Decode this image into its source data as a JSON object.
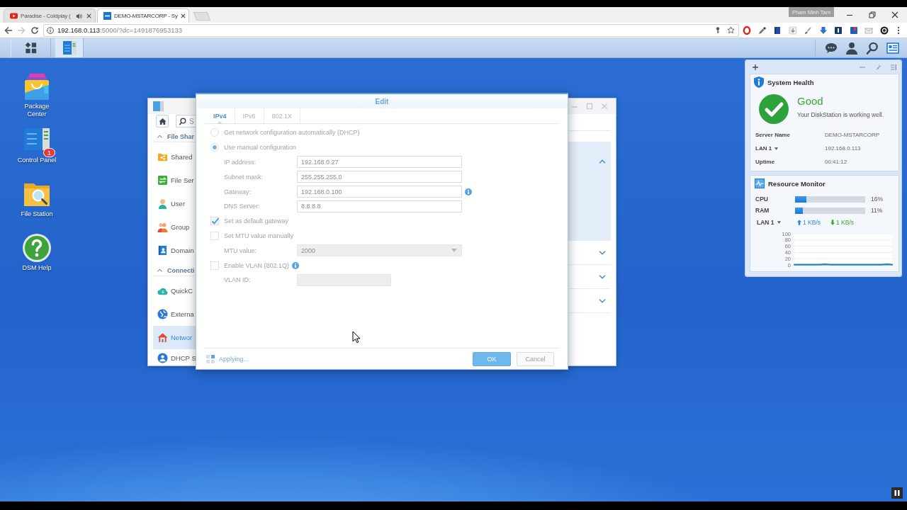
{
  "browser": {
    "tabs": [
      {
        "kind": "video",
        "title": "Paradise - Coldplay (",
        "selected": false,
        "audio": true
      },
      {
        "kind": "app",
        "title": "DEMO-MSTARCORP - Sy",
        "selected": true,
        "audio": false
      }
    ],
    "profile": "Pham Minh Tam",
    "url": {
      "host": "192.168.0.113",
      "rest": ":5000/?dc=1491876953133"
    }
  },
  "taskbar": {
    "apps": [
      {
        "kind": "main-menu",
        "selected": false
      },
      {
        "kind": "control-panel",
        "selected": true
      }
    ]
  },
  "desktop_icons": [
    {
      "kind": "package",
      "label": "Package Center"
    },
    {
      "kind": "control-panel",
      "label": "Control Panel",
      "badge": "1"
    },
    {
      "kind": "file-station",
      "label": "File Station"
    },
    {
      "kind": "help",
      "label": "DSM Help"
    }
  ],
  "control_panel": {
    "search": {
      "placeholder": "S"
    },
    "sections": [
      {
        "title": "File Shar",
        "expanded": true,
        "items": [
          {
            "kind": "shared",
            "label": "Shared",
            "selected": false
          },
          {
            "kind": "file-services",
            "label": "File Ser",
            "selected": false
          },
          {
            "kind": "user",
            "label": "User",
            "selected": false
          },
          {
            "kind": "group",
            "label": "Group",
            "selected": false
          },
          {
            "kind": "domain",
            "label": "Domain",
            "selected": false
          }
        ]
      },
      {
        "title": "Connecti",
        "expanded": true,
        "items": [
          {
            "kind": "quickconnect",
            "label": "QuickC",
            "selected": false
          },
          {
            "kind": "external",
            "label": "Externa",
            "selected": false
          },
          {
            "kind": "network",
            "label": "Networ",
            "selected": true
          },
          {
            "kind": "dhcp",
            "label": "DHCP S",
            "selected": false
          }
        ]
      }
    ],
    "interfaces": [
      {
        "expanded": true,
        "selected": true
      },
      {
        "expanded": false,
        "selected": false
      },
      {
        "expanded": false,
        "selected": false
      },
      {
        "expanded": false,
        "selected": false
      }
    ]
  },
  "dialog": {
    "title": "Edit",
    "tabs": [
      {
        "label": "IPv4",
        "selected": true
      },
      {
        "label": "IPv6",
        "selected": false
      },
      {
        "label": "802.1X",
        "selected": false
      }
    ],
    "rows": [
      {
        "kind": "radio",
        "label": "Get network configuration automatically (DHCP)",
        "selected": false,
        "disabled": false,
        "info": false
      },
      {
        "kind": "radio",
        "label": "Use manual configuration",
        "selected": true,
        "disabled": false,
        "info": false
      },
      {
        "kind": "field",
        "label": "IP address:",
        "value": "192.168.0.27",
        "disabled": false,
        "info": false
      },
      {
        "kind": "field",
        "label": "Subnet mask:",
        "value": "255.255.255.0",
        "disabled": false,
        "info": false
      },
      {
        "kind": "field",
        "label": "Gateway:",
        "value": "192.168.0.100",
        "disabled": false,
        "info": true
      },
      {
        "kind": "field",
        "label": "DNS Server:",
        "value": "8.8.8.8",
        "disabled": false,
        "info": false
      },
      {
        "kind": "checkbox",
        "label": "Set as default gateway",
        "checked": true,
        "disabled": false,
        "info": false
      },
      {
        "kind": "checkbox",
        "label": "Set MTU value manually",
        "checked": false,
        "disabled": false,
        "info": false
      },
      {
        "kind": "select",
        "label": "MTU value:",
        "value": "2000",
        "disabled": true,
        "info": false
      },
      {
        "kind": "checkbox",
        "label": "Enable VLAN (802.1Q)",
        "checked": false,
        "disabled": false,
        "info": true
      },
      {
        "kind": "short-field",
        "label": "VLAN ID:",
        "disabled": true,
        "info": false
      }
    ],
    "status": "Applying...",
    "buttons": [
      {
        "kind": "primary",
        "label": "OK"
      },
      {
        "kind": "secondary",
        "label": "Cancel"
      }
    ]
  },
  "widgets": {
    "health": {
      "title": "System Health",
      "status": "Good",
      "message": "Your DiskStation is working well.",
      "rows": [
        {
          "label": "Server Name",
          "value": "DEMO-MSTARCORP",
          "dropdown": false
        },
        {
          "label": "LAN 1",
          "value": "192.168.0.113",
          "dropdown": true
        },
        {
          "label": "Uptime",
          "value": "00:41:12",
          "dropdown": false
        }
      ]
    },
    "monitor": {
      "title": "Resource Monitor",
      "meters": [
        {
          "label": "CPU",
          "level": 0.16,
          "reading": "16%"
        },
        {
          "label": "RAM",
          "level": 0.11,
          "reading": "11%"
        }
      ],
      "lan": {
        "label": "LAN 1",
        "upload": "1 KB/s",
        "download": "1 KB/s"
      },
      "chart_data": {
        "type": "line",
        "ylim": [
          0,
          100
        ],
        "yticks": [
          0,
          20,
          40,
          60,
          80,
          100
        ],
        "grid": true,
        "values": [
          1,
          1,
          1,
          1,
          1,
          1,
          2,
          1,
          1,
          1,
          1,
          1,
          1,
          1,
          1,
          1,
          1,
          1,
          2,
          1
        ]
      }
    }
  }
}
